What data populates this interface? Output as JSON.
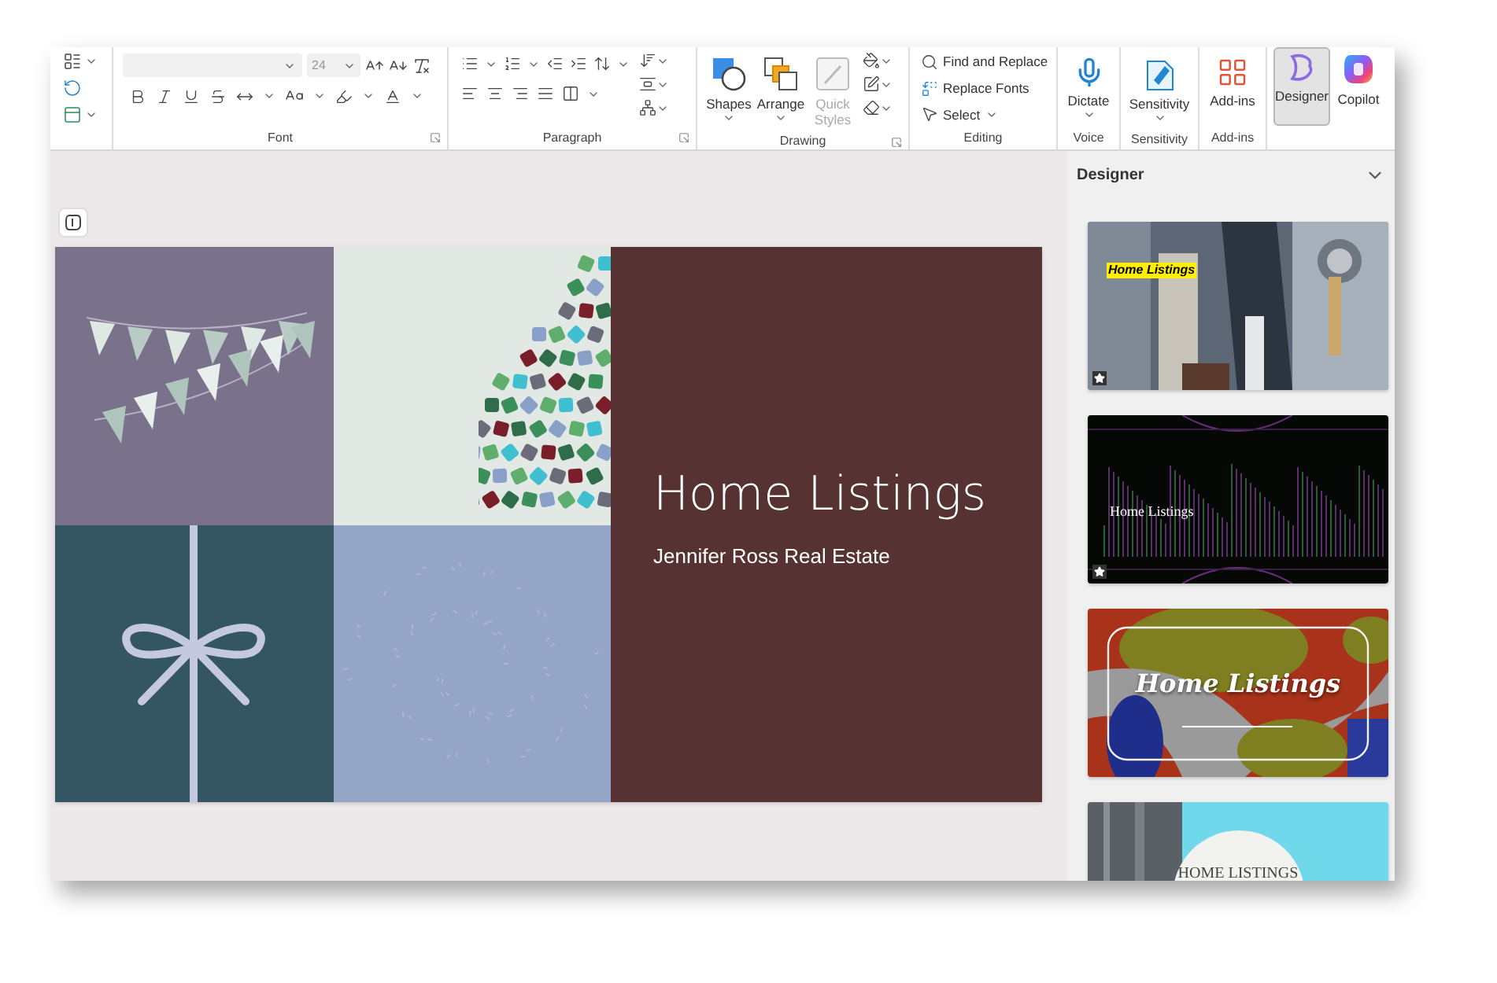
{
  "font_group": {
    "font_size": "24",
    "label": "Font"
  },
  "paragraph_group": {
    "label": "Paragraph"
  },
  "drawing_group": {
    "label": "Drawing",
    "buttons": [
      {
        "kind": "shapes",
        "label": "Shapes",
        "disabled": false
      },
      {
        "kind": "arrange",
        "label": "Arrange",
        "disabled": false
      },
      {
        "kind": "quick_styles",
        "label": "Quick Styles",
        "disabled": true
      }
    ]
  },
  "editing_group": {
    "label": "Editing",
    "items": [
      {
        "kind": "find",
        "label": "Find and Replace"
      },
      {
        "kind": "replace_fonts",
        "label": "Replace Fonts"
      },
      {
        "kind": "select",
        "label": "Select"
      }
    ]
  },
  "voice_group": {
    "button": "Dictate",
    "label": "Voice"
  },
  "sensitivity_group": {
    "button": "Sensitivity",
    "label": "Sensitivity"
  },
  "addins_group": {
    "button": "Add-ins",
    "label": "Add-ins"
  },
  "designer_button": {
    "label": "Designer",
    "selected": true
  },
  "copilot_button": {
    "label": "Copilot"
  },
  "slide": {
    "title": "Home Listings",
    "subtitle": "Jennifer Ross Real Estate"
  },
  "designer_pane": {
    "title": "Designer",
    "designs": [
      {
        "title": "Home Listings",
        "badge": true
      },
      {
        "kind": "dark",
        "title": "Home Listings",
        "badge": true
      },
      {
        "kind": "abstract",
        "title": "Home Listings",
        "badge": false
      },
      {
        "kind": "circle",
        "title": "HOME LISTINGS",
        "badge": false
      }
    ]
  }
}
